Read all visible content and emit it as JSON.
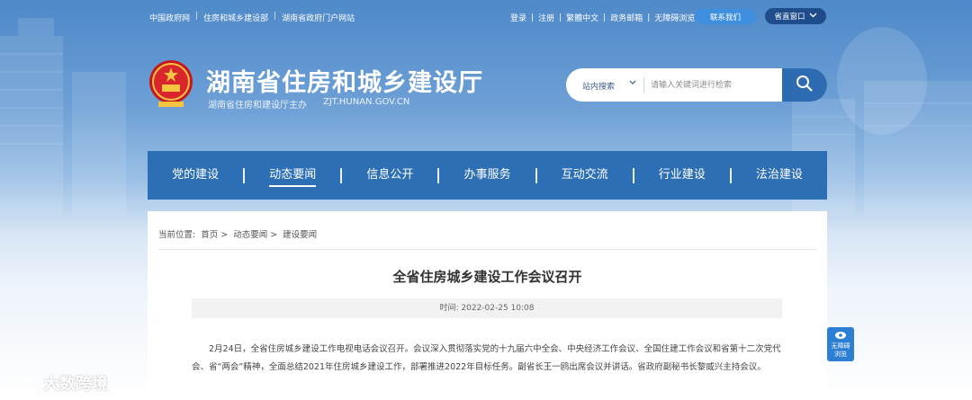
{
  "top": {
    "links_left": [
      "中国政府网",
      "住房和城乡建设部",
      "湖南省政府门户网站"
    ],
    "links_right": [
      "登录",
      "注册",
      "繁體中文",
      "政务邮箱",
      "无障碍浏览"
    ],
    "contact_label": "联系我们",
    "window_label": "省直窗口"
  },
  "header": {
    "title": "湖南省住房和城乡建设厅",
    "host": "湖南省住房和建设厅主办",
    "domain": "ZJT.HUNAN.GOV.CN"
  },
  "search": {
    "scope": "站内搜索",
    "placeholder": "请输入关键词进行检索"
  },
  "nav": {
    "items": [
      "党的建设",
      "动态要闻",
      "信息公开",
      "办事服务",
      "互动交流",
      "行业建设",
      "法治建设"
    ],
    "active": "动态要闻"
  },
  "breadcrumb": {
    "label": "当前位置:",
    "items": [
      "首页 >",
      "动态要闻 >",
      "建设要闻"
    ]
  },
  "article": {
    "title": "全省住房城乡建设工作会议召开",
    "time_label": "时间:",
    "time": "2022-02-25 10:08",
    "body": "2月24日，全省住房城乡建设工作电视电话会议召开。会议深入贯彻落实党的十九届六中全会、中央经济工作会议、全国住建工作会议和省第十二次党代会、省“两会”精神，全面总结2021年住房城乡建设工作，部署推进2022年目标任务。副省长王一鸥出席会议并讲话。省政府副秘书长黎威兴主持会议。"
  },
  "accessibility": {
    "line1": "无障碍",
    "line2": "浏览"
  },
  "watermark": "大数跨境",
  "colors": {
    "nav": "#2d6fb4",
    "header_bg": "#4e89c9",
    "search_button": "#2d6cb2",
    "contact_button": "#3f8fe0",
    "window_button": "#1f4d8c"
  }
}
